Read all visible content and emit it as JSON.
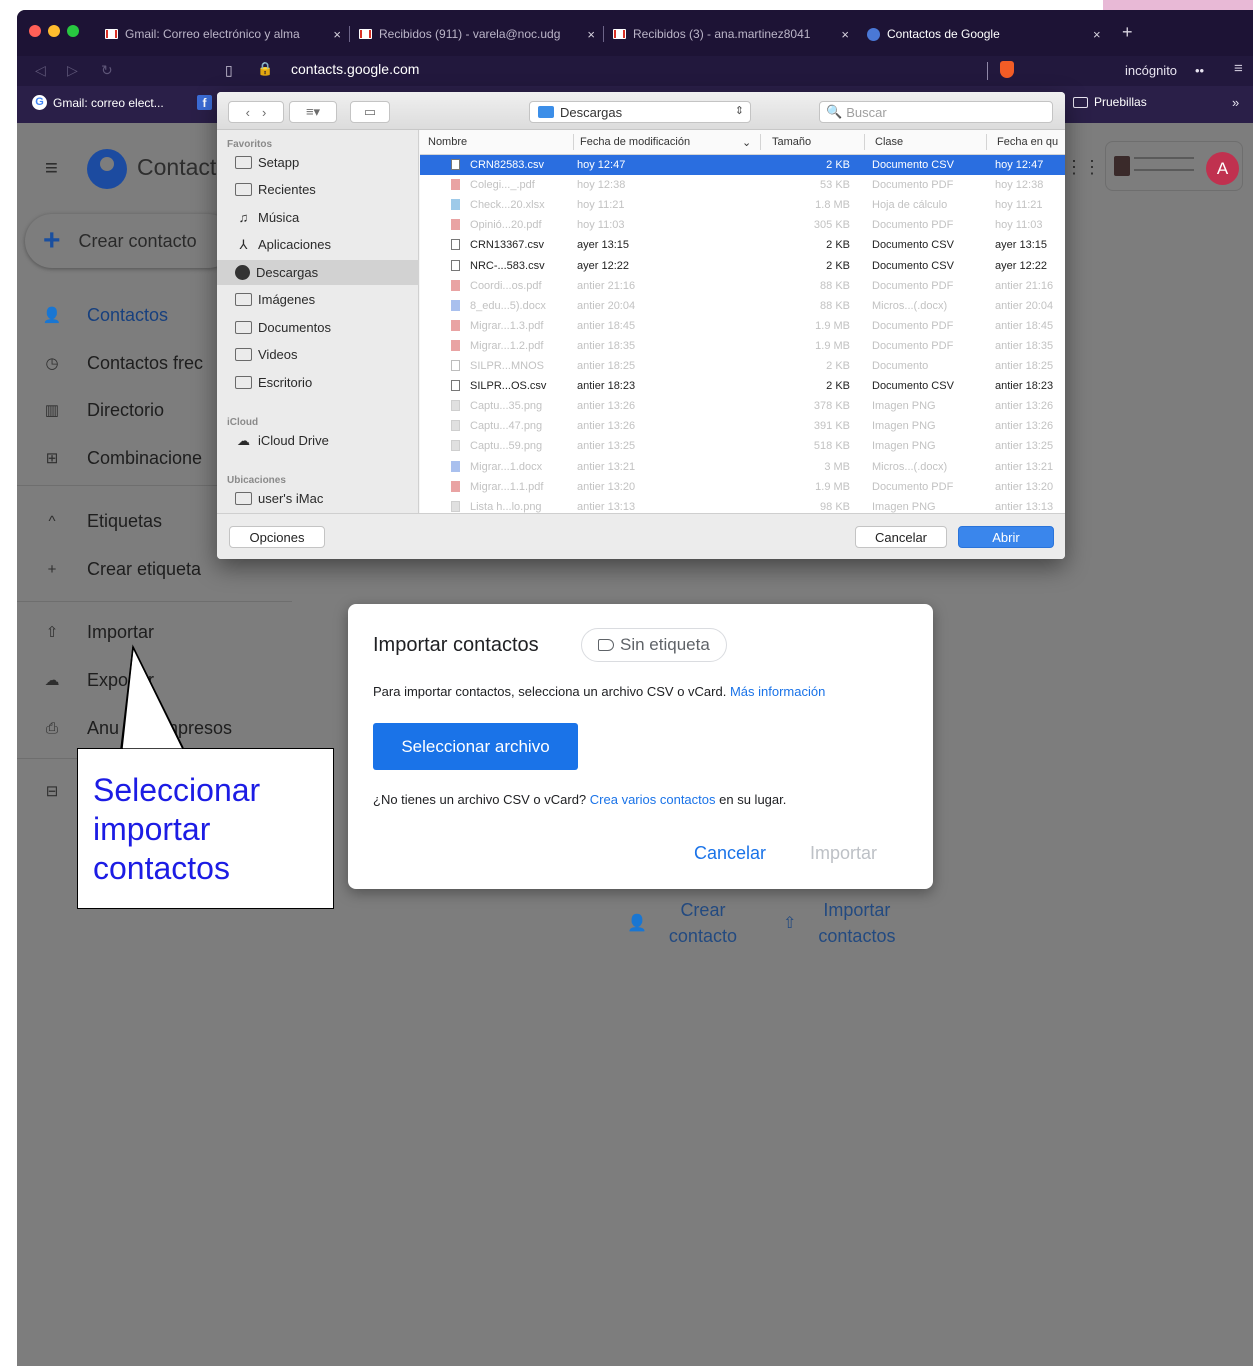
{
  "browser": {
    "tabs": [
      {
        "label": "Gmail: Correo electrónico y alma",
        "icon": "gmail-icon"
      },
      {
        "label": "Recibidos (911) - varela@noc.udg",
        "icon": "gmail-icon"
      },
      {
        "label": "Recibidos (3) - ana.martinez8041",
        "icon": "gmail-icon"
      },
      {
        "label": "Contactos de Google",
        "icon": "contacts-icon"
      }
    ],
    "tab_close": "×",
    "new_tab": "+",
    "url": "contacts.google.com",
    "incognito_label": "incógnito",
    "bookmarks": [
      {
        "label": "Gmail: correo elect...",
        "icon": "google-icon"
      },
      {
        "label": "f",
        "icon": "facebook-icon"
      },
      {
        "label": "Pruebillas",
        "icon": "folder-icon"
      }
    ],
    "bookmarks_more": "»"
  },
  "contacts_page": {
    "app_title": "Contact",
    "create_contact": "Crear contacto",
    "nav": [
      {
        "label": "Contactos",
        "icon": "person-icon",
        "active": true
      },
      {
        "label": "Contactos frec",
        "icon": "history-icon"
      },
      {
        "label": "Directorio",
        "icon": "building-icon"
      },
      {
        "label": "Combinacione",
        "icon": "merge-icon"
      }
    ],
    "labels_section": "Etiquetas",
    "create_label": "Crear etiqueta",
    "nav2": [
      {
        "label": "Importar",
        "icon": "upload-icon"
      },
      {
        "label": "Expo  ar",
        "icon": "cloud-download-icon"
      },
      {
        "label": "Anu        impresos",
        "icon": "print-icon"
      }
    ],
    "empty_actions": [
      {
        "line1": "Crear",
        "line2": "contacto",
        "icon": "person-add-icon"
      },
      {
        "line1": "Importar",
        "line2": "contactos",
        "icon": "upload-icon"
      }
    ],
    "avatar_letter": "A"
  },
  "import_dialog": {
    "title": "Importar contactos",
    "chip_label": "Sin etiqueta",
    "instruction": "Para importar contactos, selecciona un archivo CSV o vCard.",
    "more_info": "Más información",
    "select_button": "Seleccionar archivo",
    "alt_prefix": "¿No tienes un archivo CSV o vCard?",
    "alt_link": "Crea varios contactos",
    "alt_suffix": "en su lugar.",
    "cancel": "Cancelar",
    "import": "Importar"
  },
  "callout": {
    "text": "Seleccionar\nimportar\ncontactos"
  },
  "file_dialog": {
    "location": "Descargas",
    "search_placeholder": "Buscar",
    "sidebar": {
      "favorites_title": "Favoritos",
      "favorites": [
        "Setapp",
        "Recientes",
        "Música",
        "Aplicaciones",
        "Descargas",
        "Imágenes",
        "Documentos",
        "Videos",
        "Escritorio"
      ],
      "selected": "Descargas",
      "icloud_title": "iCloud",
      "icloud": [
        "iCloud Drive"
      ],
      "locations_title": "Ubicaciones",
      "locations": [
        "user's iMac"
      ]
    },
    "columns": {
      "name": "Nombre",
      "modified": "Fecha de modificación",
      "size": "Tamaño",
      "kind": "Clase",
      "added": "Fecha en qu"
    },
    "files": [
      {
        "name": "CRN82583.csv",
        "modified": "hoy 12:47",
        "size": "2 KB",
        "kind": "Documento CSV",
        "added": "hoy 12:47",
        "type": "csv",
        "enabled": true,
        "selected": true
      },
      {
        "name": "Colegi..._.pdf",
        "modified": "hoy 12:38",
        "size": "53 KB",
        "kind": "Documento PDF",
        "added": "hoy 12:38",
        "type": "pdf",
        "enabled": false
      },
      {
        "name": "Check...20.xlsx",
        "modified": "hoy 11:21",
        "size": "1.8 MB",
        "kind": "Hoja de cálculo",
        "added": "hoy 11:21",
        "type": "xls",
        "enabled": false
      },
      {
        "name": "Opinió...20.pdf",
        "modified": "hoy 11:03",
        "size": "305 KB",
        "kind": "Documento PDF",
        "added": "hoy 11:03",
        "type": "pdf",
        "enabled": false
      },
      {
        "name": "CRN13367.csv",
        "modified": "ayer 13:15",
        "size": "2 KB",
        "kind": "Documento CSV",
        "added": "ayer 13:15",
        "type": "csv",
        "enabled": true
      },
      {
        "name": "NRC-...583.csv",
        "modified": "ayer 12:22",
        "size": "2 KB",
        "kind": "Documento CSV",
        "added": "ayer 12:22",
        "type": "csv",
        "enabled": true
      },
      {
        "name": "Coordi...os.pdf",
        "modified": "antier 21:16",
        "size": "88 KB",
        "kind": "Documento PDF",
        "added": "antier 21:16",
        "type": "pdf",
        "enabled": false
      },
      {
        "name": "8_edu...5).docx",
        "modified": "antier 20:04",
        "size": "88 KB",
        "kind": "Micros...(.docx)",
        "added": "antier 20:04",
        "type": "doc",
        "enabled": false
      },
      {
        "name": "Migrar...1.3.pdf",
        "modified": "antier 18:45",
        "size": "1.9 MB",
        "kind": "Documento PDF",
        "added": "antier 18:45",
        "type": "pdf",
        "enabled": false
      },
      {
        "name": "Migrar...1.2.pdf",
        "modified": "antier 18:35",
        "size": "1.9 MB",
        "kind": "Documento PDF",
        "added": "antier 18:35",
        "type": "pdf",
        "enabled": false
      },
      {
        "name": "SILPR...MNOS",
        "modified": "antier 18:25",
        "size": "2 KB",
        "kind": "Documento",
        "added": "antier 18:25",
        "type": "generic",
        "enabled": false
      },
      {
        "name": "SILPR...OS.csv",
        "modified": "antier 18:23",
        "size": "2 KB",
        "kind": "Documento CSV",
        "added": "antier 18:23",
        "type": "csv",
        "enabled": true
      },
      {
        "name": "Captu...35.png",
        "modified": "antier 13:26",
        "size": "378 KB",
        "kind": "Imagen PNG",
        "added": "antier 13:26",
        "type": "png",
        "enabled": false
      },
      {
        "name": "Captu...47.png",
        "modified": "antier 13:26",
        "size": "391 KB",
        "kind": "Imagen PNG",
        "added": "antier 13:26",
        "type": "png",
        "enabled": false
      },
      {
        "name": "Captu...59.png",
        "modified": "antier 13:25",
        "size": "518 KB",
        "kind": "Imagen PNG",
        "added": "antier 13:25",
        "type": "png",
        "enabled": false
      },
      {
        "name": "Migrar...1.docx",
        "modified": "antier 13:21",
        "size": "3 MB",
        "kind": "Micros...(.docx)",
        "added": "antier 13:21",
        "type": "doc",
        "enabled": false
      },
      {
        "name": "Migrar...1.1.pdf",
        "modified": "antier 13:20",
        "size": "1.9 MB",
        "kind": "Documento PDF",
        "added": "antier 13:20",
        "type": "pdf",
        "enabled": false
      },
      {
        "name": "Lista h...lo.png",
        "modified": "antier 13:13",
        "size": "98 KB",
        "kind": "Imagen PNG",
        "added": "antier 13:13",
        "type": "png",
        "enabled": false
      }
    ],
    "options_button": "Opciones",
    "cancel_button": "Cancelar",
    "open_button": "Abrir"
  }
}
